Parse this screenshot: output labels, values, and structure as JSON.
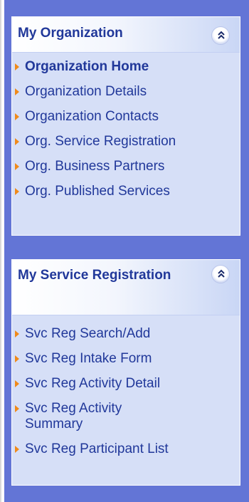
{
  "panels": [
    {
      "title": "My Organization",
      "collapse_icon": "double-chevron-up-icon",
      "items": [
        {
          "label": "Organization Home",
          "active": true
        },
        {
          "label": "Organization Details"
        },
        {
          "label": "Organization Contacts"
        },
        {
          "label": "Org. Service Registration"
        },
        {
          "label": "Org. Business Partners"
        },
        {
          "label": "Org. Published Services"
        }
      ]
    },
    {
      "title": "My Service Registration",
      "collapse_icon": "double-chevron-up-icon",
      "items": [
        {
          "label": "Svc Reg Search/Add"
        },
        {
          "label": "Svc Reg Intake Form"
        },
        {
          "label": "Svc Reg Activity Detail"
        },
        {
          "label": "Svc Reg Activity Summary"
        },
        {
          "label": "Svc Reg Participant List"
        }
      ]
    }
  ],
  "colors": {
    "sidebar_bg": "#6375d6",
    "panel_bg": "#d6dff7",
    "link_text": "#21389a",
    "bullet": "#f08a1a"
  }
}
